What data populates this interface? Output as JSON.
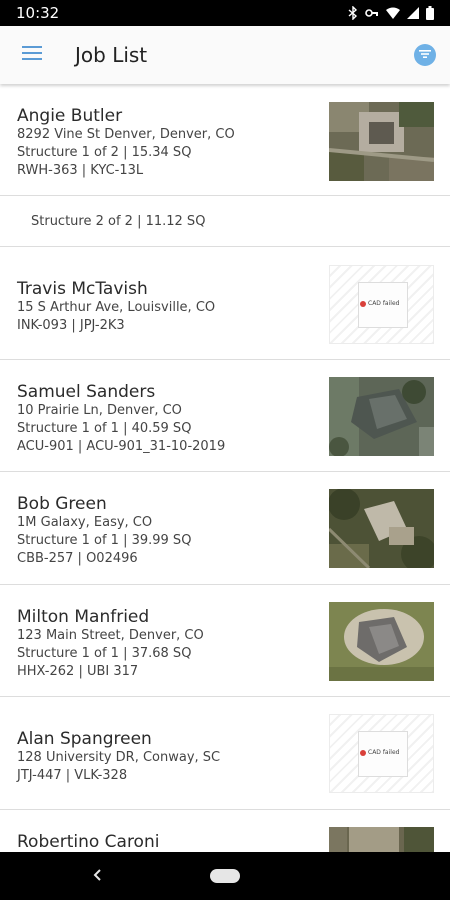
{
  "status_bar": {
    "time": "10:32",
    "icons": [
      "bluetooth-icon",
      "key-icon",
      "wifi-icon",
      "signal-icon",
      "battery-icon"
    ]
  },
  "app_bar": {
    "title": "Job List",
    "menu_icon": "hamburger-menu-icon",
    "filter_icon": "filter-icon",
    "accent": "#6fb1e6"
  },
  "jobs": [
    {
      "name": "Angie Butler",
      "address": "8292 Vine St Denver, Denver, CO",
      "structure": "Structure 1 of 2 | 15.34 SQ",
      "ids": "RWH-363 | KYC-13L",
      "thumbnail": "aerial"
    },
    {
      "structure": "Structure 2 of 2 | 11.12 SQ"
    },
    {
      "name": "Travis McTavish",
      "address": "15 S Arthur Ave, Louisville, CO",
      "ids": "INK-093 | JPJ-2K3",
      "thumbnail": "cad-failed",
      "thumbnail_label": "CAD failed"
    },
    {
      "name": "Samuel Sanders",
      "address": "10 Prairie Ln, Denver, CO",
      "structure": "Structure 1 of 1 | 40.59 SQ",
      "ids": "ACU-901 | ACU-901_31-10-2019",
      "thumbnail": "aerial"
    },
    {
      "name": "Bob Green",
      "address": "1M Galaxy, Easy, CO",
      "structure": "Structure 1 of 1 | 39.99 SQ",
      "ids": "CBB-257 | O02496",
      "thumbnail": "aerial"
    },
    {
      "name": "Milton Manfried",
      "address": "123 Main Street, Denver, CO",
      "structure": "Structure 1 of 1 | 37.68 SQ",
      "ids": "HHX-262 | UBI 317",
      "thumbnail": "aerial"
    },
    {
      "name": "Alan Spangreen",
      "address": "128 University DR, Conway, SC",
      "ids": "JTJ-447 | VLK-328",
      "thumbnail": "cad-failed",
      "thumbnail_label": "CAD failed"
    },
    {
      "name": "Robertino Caroni",
      "thumbnail": "aerial"
    }
  ],
  "nav_bar": {
    "back_icon": "back-chevron-icon",
    "home_icon": "home-pill-icon"
  }
}
